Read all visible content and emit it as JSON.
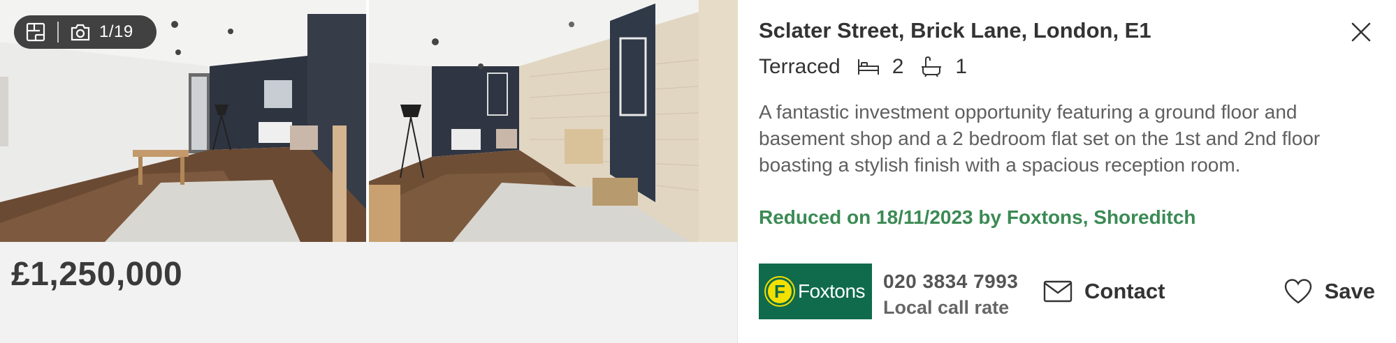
{
  "gallery": {
    "counter": "1/19",
    "floorplan_icon": "floorplan-icon",
    "camera_icon": "camera-icon"
  },
  "price": "£1,250,000",
  "listing": {
    "address": "Sclater Street, Brick Lane, London, E1",
    "property_type": "Terraced",
    "bedrooms": "2",
    "bathrooms": "1",
    "description": "A fantastic investment opportunity featuring a ground floor and basement shop and a 2 bedroom flat set on the 1st and 2nd floor boasting a stylish finish with a spacious reception room.",
    "reduced_note": "Reduced on 18/11/2023 by Foxtons, Shoreditch"
  },
  "agent": {
    "logo_text": "Foxtons",
    "logo_letter": "F",
    "phone": "020 3834 7993",
    "phone_note": "Local call rate",
    "brand_color": "#0f6b4b"
  },
  "actions": {
    "contact_label": "Contact",
    "save_label": "Save"
  },
  "colors": {
    "reduced_text": "#3b8a54",
    "price_text": "#3a3a3a",
    "panel_bg": "#f2f2f2"
  }
}
